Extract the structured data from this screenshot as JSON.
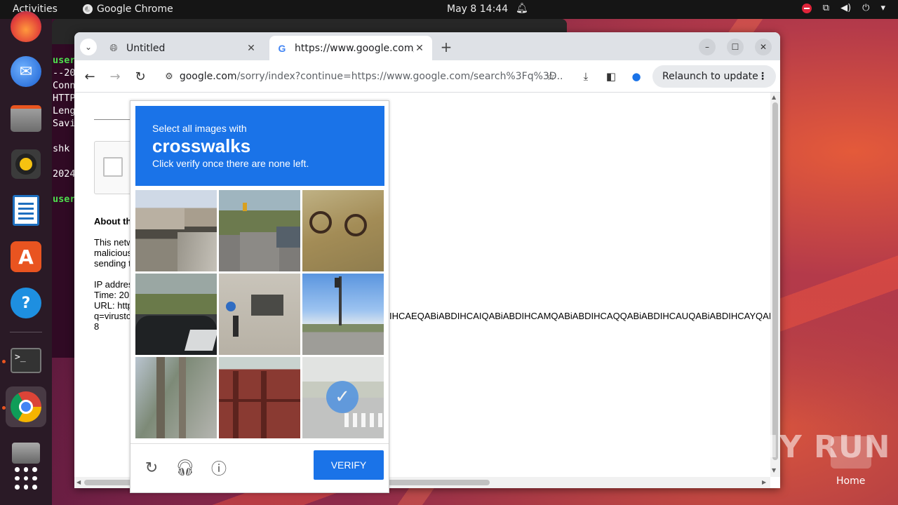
{
  "topbar": {
    "activities": "Activities",
    "app_name": "Google Chrome",
    "clock": "May 8  14:44"
  },
  "dock": {
    "items": [
      "firefox-icon",
      "thunderbird-icon",
      "files-icon",
      "rhythmbox-icon",
      "writer-icon",
      "app-center-icon",
      "help-icon",
      "terminal-icon",
      "chrome-icon",
      "disks-icon",
      "show-apps-icon"
    ]
  },
  "terminal": {
    "lines": [
      "user",
      "--20",
      "Conn",
      "HTTP",
      "Leng",
      "Savi",
      "",
      "shk",
      "",
      "2024",
      "",
      "user"
    ]
  },
  "browser": {
    "tabs": [
      {
        "label": "Untitled",
        "active": false
      },
      {
        "label": "https://www.google.com/",
        "active": true
      }
    ],
    "url_host": "google.com",
    "url_path": "/sorry/index?continue=https://www.google.com/search%3Fq%3D...",
    "relaunch_label": "Relaunch to update"
  },
  "page": {
    "about_label": "About th",
    "text1": "This netw",
    "text2": "malicious",
    "text3": "sending t",
    "ip_label": "IP addres",
    "time_label": "Time: 20",
    "url_label": "URL: http",
    "q_label": "q=virustc",
    "num_label": "8",
    "long_query": "IHCAEQABiABDIHCAIQABiABDIHCAMQABiABDIHCAQQABiABDIHCAUQABiABDIHCAYQAB"
  },
  "captcha": {
    "line1": "Select all images with",
    "line2": "crosswalks",
    "line3": "Click verify once there are none left.",
    "verify_label": "VERIFY",
    "tiles": [
      {
        "scene": "street-shops",
        "selected": false
      },
      {
        "scene": "street-traffic-lights",
        "selected": false
      },
      {
        "scene": "bicycle",
        "selected": false
      },
      {
        "scene": "parked-car",
        "selected": false
      },
      {
        "scene": "traffic-sign-plaque",
        "selected": false
      },
      {
        "scene": "traffic-light-sky",
        "selected": false
      },
      {
        "scene": "trees-sidewalk",
        "selected": false
      },
      {
        "scene": "bridge",
        "selected": false
      },
      {
        "scene": "crosswalk-road",
        "selected": true
      }
    ]
  },
  "desktop": {
    "watermark": "ANY RUN",
    "home_label": "Home"
  },
  "colors": {
    "accent": "#1a73e8",
    "terminal_bg": "#300a24",
    "ubuntu_orange": "#e95420"
  }
}
